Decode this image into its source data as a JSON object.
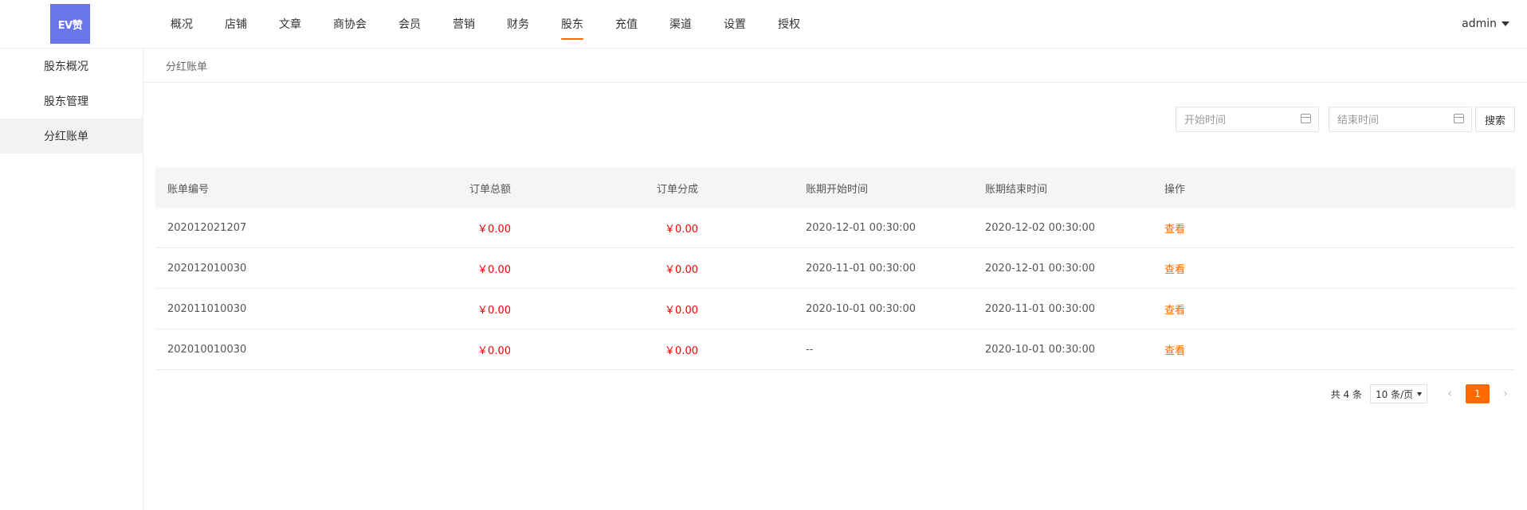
{
  "header": {
    "logo_text": "EV赞",
    "nav": [
      "概况",
      "店铺",
      "文章",
      "商协会",
      "会员",
      "营销",
      "财务",
      "股东",
      "充值",
      "渠道",
      "设置",
      "授权"
    ],
    "active_nav": "股东",
    "user": "admin"
  },
  "sidebar": {
    "items": [
      "股东概况",
      "股东管理",
      "分红账单"
    ],
    "active": "分红账单"
  },
  "breadcrumb": "分红账单",
  "search": {
    "start_placeholder": "开始时间",
    "end_placeholder": "结束时间",
    "button": "搜索"
  },
  "table": {
    "headers": [
      "账单编号",
      "订单总额",
      "订单分成",
      "账期开始时间",
      "账期结束时间",
      "操作"
    ],
    "rows": [
      {
        "id": "202012021207",
        "total": "￥0.00",
        "share": "￥0.00",
        "start": "2020-12-01 00:30:00",
        "end": "2020-12-02 00:30:00",
        "action": "查看"
      },
      {
        "id": "202012010030",
        "total": "￥0.00",
        "share": "￥0.00",
        "start": "2020-11-01 00:30:00",
        "end": "2020-12-01 00:30:00",
        "action": "查看"
      },
      {
        "id": "202011010030",
        "total": "￥0.00",
        "share": "￥0.00",
        "start": "2020-10-01 00:30:00",
        "end": "2020-11-01 00:30:00",
        "action": "查看"
      },
      {
        "id": "202010010030",
        "total": "￥0.00",
        "share": "￥0.00",
        "start": "--",
        "end": "2020-10-01 00:30:00",
        "action": "查看"
      }
    ]
  },
  "pagination": {
    "total": "共 4 条",
    "page_size": "10 条/页",
    "current_page": "1",
    "prev": "‹",
    "next": "›"
  },
  "colors": {
    "accent": "#ff6a00",
    "logo_bg": "#6b75ea",
    "amount": "#ff0000"
  }
}
